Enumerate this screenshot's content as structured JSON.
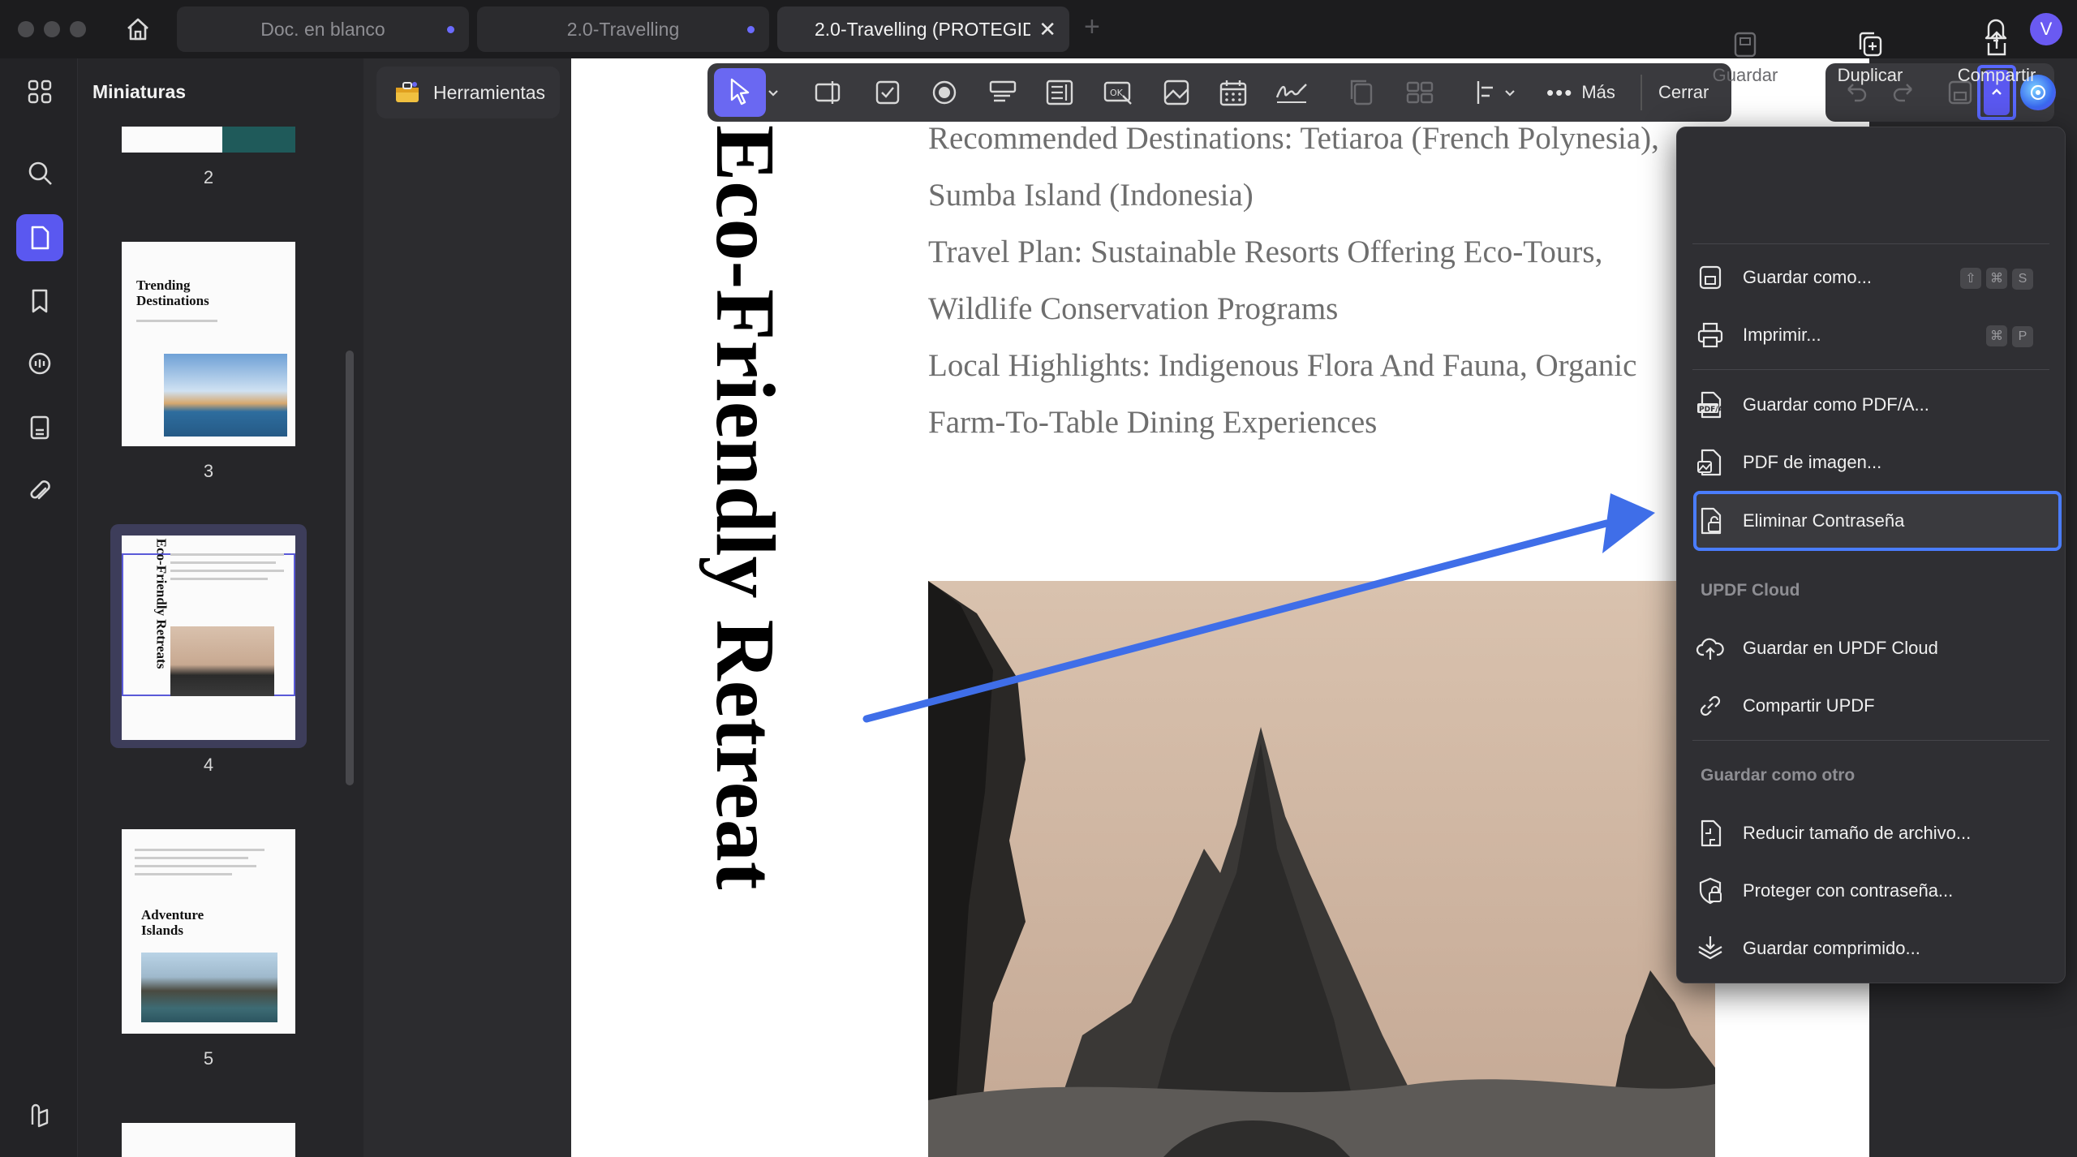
{
  "tabs": [
    {
      "label": "Doc. en blanco",
      "modified": true
    },
    {
      "label": "2.0-Travelling",
      "modified": true
    },
    {
      "label": "2.0-Travelling (PROTEGIDO)",
      "active": true
    }
  ],
  "user_avatar": "V",
  "sidebar": {
    "title": "Miniaturas",
    "pages": [
      "2",
      "3",
      "4",
      "5"
    ],
    "thumb3": {
      "title": "Trending Destinations"
    },
    "thumb4": {
      "title": "Eco-Friendly Retreats"
    },
    "thumb5": {
      "title": "Adventure Islands"
    }
  },
  "tools_button": "Herramientas",
  "toolbar": {
    "more_label": "Más",
    "close_label": "Cerrar"
  },
  "document": {
    "vertical_title": "Eco-Friendly Retreat",
    "lines": [
      "Recommended Destinations: Tetiaroa (French Polynesia),",
      "Sumba Island (Indonesia)",
      "Travel Plan: Sustainable Resorts Offering Eco-Tours,",
      "Wildlife Conservation Programs",
      "Local Highlights: Indigenous Flora And Fauna, Organic",
      "Farm-To-Table Dining Experiences"
    ]
  },
  "menu": {
    "top_actions": [
      {
        "label": "Guardar",
        "icon": "save-icon",
        "disabled": true
      },
      {
        "label": "Duplicar",
        "icon": "duplicate-icon"
      },
      {
        "label": "Compartir",
        "icon": "share-icon"
      }
    ],
    "items": [
      {
        "label": "Guardar como...",
        "icon": "save-as-icon",
        "shortcut": [
          "⇧",
          "⌘",
          "S"
        ]
      },
      {
        "label": "Imprimir...",
        "icon": "print-icon",
        "shortcut": [
          "⌘",
          "P"
        ]
      },
      {
        "label": "Guardar como PDF/A...",
        "icon": "pdfa-icon"
      },
      {
        "label": "PDF de imagen...",
        "icon": "image-pdf-icon"
      },
      {
        "label": "Eliminar Contraseña",
        "icon": "remove-password-icon",
        "highlighted": true
      }
    ],
    "cloud_section": "UPDF Cloud",
    "cloud_items": [
      {
        "label": "Guardar en UPDF Cloud",
        "icon": "cloud-upload-icon"
      },
      {
        "label": "Compartir UPDF",
        "icon": "link-icon"
      }
    ],
    "other_section": "Guardar como otro",
    "other_items": [
      {
        "label": "Reducir tamaño de archivo...",
        "icon": "compress-icon"
      },
      {
        "label": "Proteger con contraseña...",
        "icon": "protect-icon"
      },
      {
        "label": "Guardar comprimido...",
        "icon": "zip-icon"
      }
    ]
  },
  "colors": {
    "accent": "#5a58f0",
    "highlight": "#4a7dff",
    "arrow": "#3f6ee8"
  }
}
